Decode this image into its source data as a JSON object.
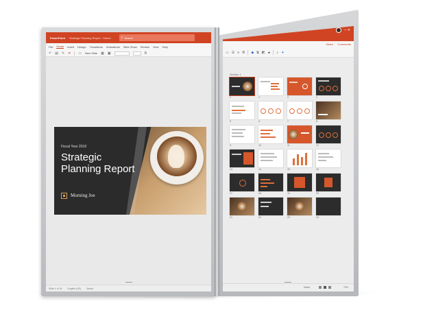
{
  "left_screen": {
    "app_name": "PowerPoint",
    "document_title": "Strategic Planning Report - Saved",
    "search": {
      "placeholder": "Search"
    },
    "ribbon_tabs": [
      "File",
      "Home",
      "Insert",
      "Design",
      "Transitions",
      "Animations",
      "Slide Show",
      "Review",
      "View",
      "Help"
    ],
    "active_tab": "Home",
    "new_slide_label": "New Slide",
    "slide": {
      "kicker": "Fiscal Year 2018",
      "title_line1": "Strategic",
      "title_line2": "Planning Report",
      "brand": "Morning Joe"
    },
    "status": {
      "slide_counter": "Slide 1 of 24",
      "language": "English (US)",
      "saved": "Saved"
    }
  },
  "right_screen": {
    "share_label": "Share",
    "comments_label": "Comments",
    "section_label": "Section 1",
    "zoom_level": "72%",
    "notes_label": "Notes",
    "slide_numbers": [
      "1",
      "2",
      "3",
      "4",
      "5",
      "6",
      "7",
      "8",
      "9",
      "10",
      "11",
      "12",
      "13",
      "14",
      "15",
      "16",
      "17",
      "18",
      "19",
      "20",
      "21",
      "22",
      "23",
      "24"
    ]
  },
  "colors": {
    "accent": "#d04423",
    "dark_slide": "#2b2b2b"
  }
}
